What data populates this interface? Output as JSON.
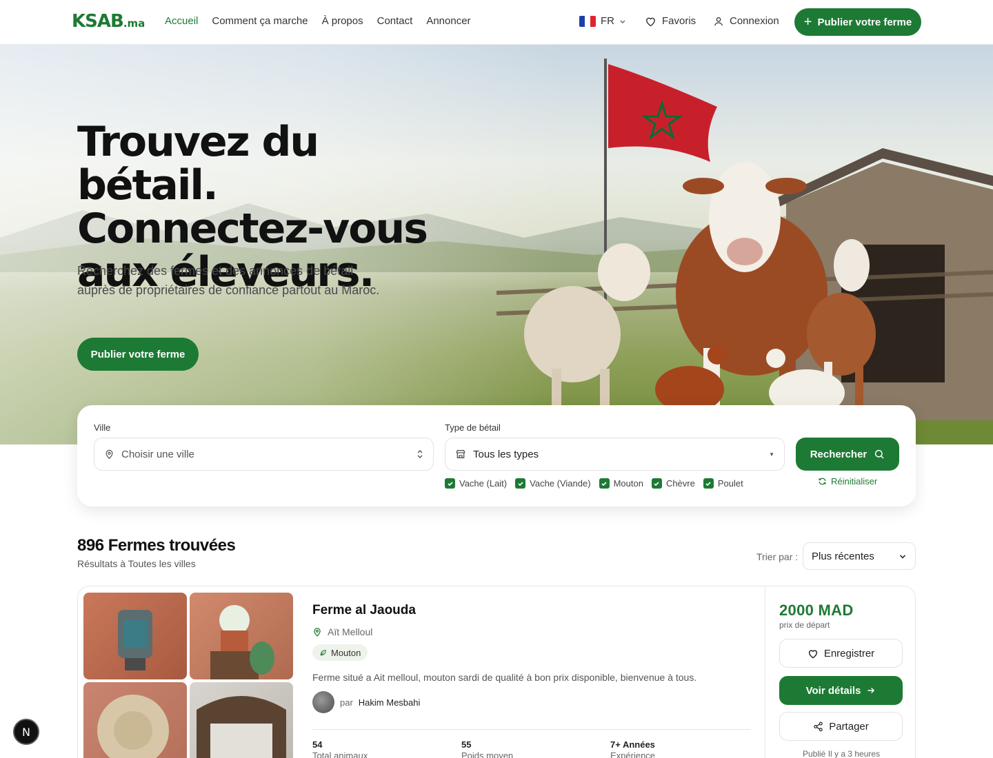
{
  "brand": {
    "name": "KSAB",
    "suffix": ".ma",
    "primary_color": "#1d7a34"
  },
  "nav": {
    "links": [
      "Accueil",
      "Comment ça marche",
      "À propos",
      "Contact",
      "Annoncer"
    ],
    "lang": "FR",
    "favorites": "Favoris",
    "login": "Connexion",
    "publish": "Publier votre ferme"
  },
  "hero": {
    "title_line1": "Trouvez du bétail.",
    "title_line2": "Connectez-vous",
    "title_line3": "aux éleveurs.",
    "subtitle": "Recherchez des fermes et des annonces de bétail auprès de propriétaires de confiance partout au Maroc.",
    "cta": "Publier votre ferme"
  },
  "search": {
    "city_label": "Ville",
    "city_placeholder": "Choisir une ville",
    "type_label": "Type de bétail",
    "type_value": "Tous les types",
    "types": [
      "Vache (Lait)",
      "Vache (Viande)",
      "Mouton",
      "Chèvre",
      "Poulet"
    ],
    "search_button": "Rechercher",
    "reset": "Réinitialiser"
  },
  "results": {
    "count": "896 Fermes trouvées",
    "subtitle": "Résultats à Toutes les villes",
    "sort_label": "Trier par :",
    "sort_value": "Plus récentes"
  },
  "listing": {
    "name": "Ferme al Jaouda",
    "location": "Aït Melloul",
    "tag": "Mouton",
    "description": "Ferme situé a Ait melloul, mouton sardi de qualité à bon prix disponible, bienvenue à tous.",
    "author_prefix": "par",
    "author": "Hakim Mesbahi",
    "stats": [
      {
        "value": "54",
        "label": "Total animaux"
      },
      {
        "value": "55",
        "label": "Poids moyen"
      },
      {
        "value": "7+ Années",
        "label": "Expérience"
      }
    ],
    "price": "2000 MAD",
    "price_sub": "prix de départ",
    "save": "Enregistrer",
    "details": "Voir détails",
    "share": "Partager",
    "posted": "Publié Il y a 3 heures"
  },
  "floating_badge": "N"
}
